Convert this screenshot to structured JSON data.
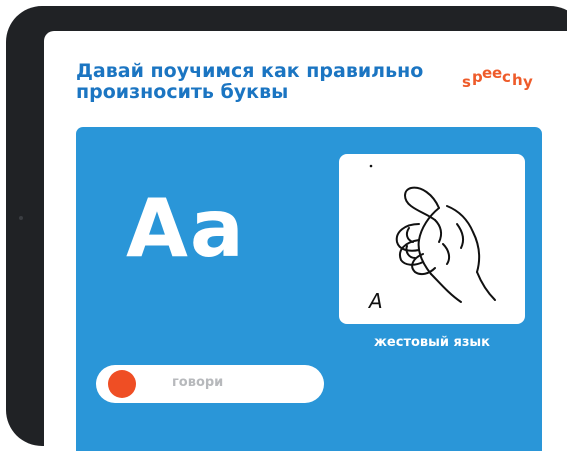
{
  "header": {
    "title": "Давай поучимся как правильно\nпроизносить буквы",
    "brand": [
      "s",
      "p",
      "e",
      "e",
      "c",
      "h",
      "y"
    ]
  },
  "lesson": {
    "letter": "Aa",
    "sign_letter": "A",
    "sign_caption": "жестовый язык",
    "speak_label": "говори"
  },
  "colors": {
    "title": "#1b75c2",
    "card": "#2a96d8",
    "brand": "#ee5b2a",
    "record_dot": "#ef4e24",
    "device_frame": "#202225"
  }
}
